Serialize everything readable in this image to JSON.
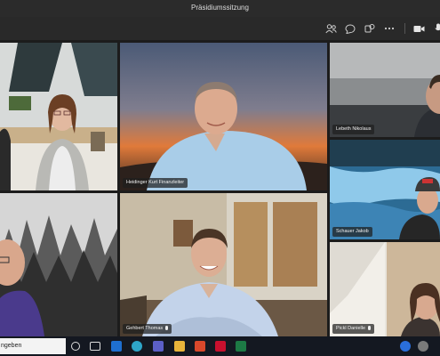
{
  "window": {
    "title": "Präsidiumssitzung"
  },
  "toolbar": {
    "icons": [
      "participants-icon",
      "chat-icon",
      "reactions-icon",
      "more-icon",
      "camera-icon",
      "microphone-icon"
    ]
  },
  "participants": [
    {
      "id": "p1",
      "name": ""
    },
    {
      "id": "p2",
      "name": "Heidinger Kurt Finanzleiter"
    },
    {
      "id": "p3",
      "name": "Lebeth Nikolaus"
    },
    {
      "id": "p4",
      "name": "Schauer Jakob"
    },
    {
      "id": "p5",
      "name": ""
    },
    {
      "id": "p6",
      "name": "Gehbert Thomas"
    },
    {
      "id": "p7",
      "name": "Pickl Danielle"
    }
  ],
  "taskbar": {
    "search_text": "ngeben",
    "apps": [
      "task-view",
      "teams-chat",
      "outlook",
      "edge",
      "teams",
      "file-explorer",
      "office",
      "acrobat",
      "excel"
    ],
    "accent": "#2a6fdb"
  }
}
